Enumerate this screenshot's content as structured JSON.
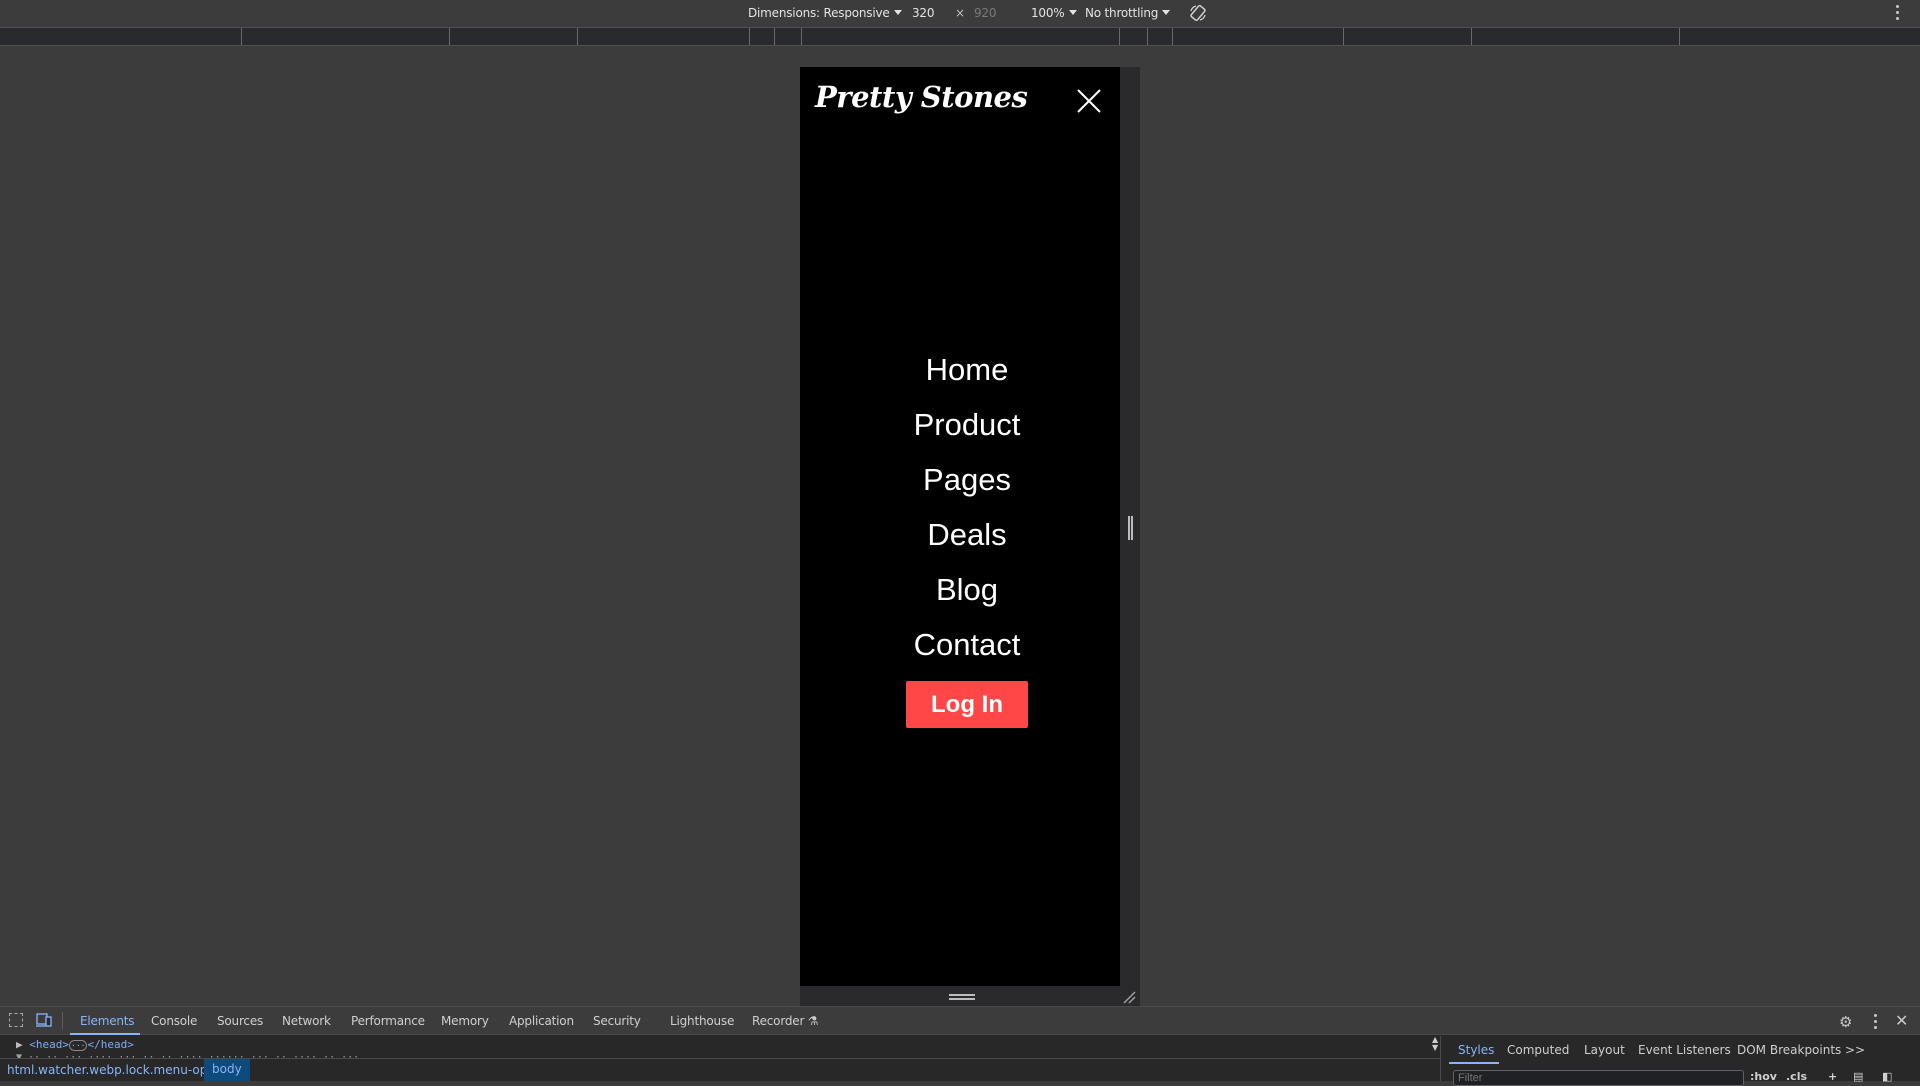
{
  "device_toolbar": {
    "dimensions_label": "Dimensions: Responsive",
    "width": "320",
    "times": "×",
    "height": "920",
    "zoom": "100%",
    "throttling": "No throttling",
    "rotate_icon": "rotate-icon",
    "more_icon": "kebab-icon"
  },
  "site": {
    "logo": "Pretty Stones",
    "close_icon": "close-icon",
    "nav": [
      {
        "label": "Home"
      },
      {
        "label": "Product"
      },
      {
        "label": "Pages"
      },
      {
        "label": "Deals"
      },
      {
        "label": "Blog"
      },
      {
        "label": "Contact"
      }
    ],
    "login_label": "Log In",
    "colors": {
      "background": "#000000",
      "login_button": "#ff4747",
      "text": "#ffffff"
    }
  },
  "devtools": {
    "tabs": [
      {
        "label": "Elements",
        "active": true
      },
      {
        "label": "Console"
      },
      {
        "label": "Sources"
      },
      {
        "label": "Network"
      },
      {
        "label": "Performance"
      },
      {
        "label": "Memory"
      },
      {
        "label": "Application"
      },
      {
        "label": "Security"
      },
      {
        "label": "Lighthouse"
      },
      {
        "label": "Recorder ⚗"
      }
    ],
    "dom_tree": {
      "head_row": "<head>",
      "head_close": "</head>",
      "ellipsis": "···"
    },
    "breadcrumbs": [
      "html.watcher.webp.lock.menu-open",
      "body"
    ],
    "side_tabs": [
      {
        "label": "Styles",
        "active": true
      },
      {
        "label": "Computed"
      },
      {
        "label": "Layout"
      },
      {
        "label": "Event Listeners"
      },
      {
        "label": "DOM Breakpoints"
      },
      {
        "label": ">>"
      }
    ],
    "filter_placeholder": "Filter",
    "style_tools": [
      ":hov",
      ".cls",
      "+"
    ]
  }
}
